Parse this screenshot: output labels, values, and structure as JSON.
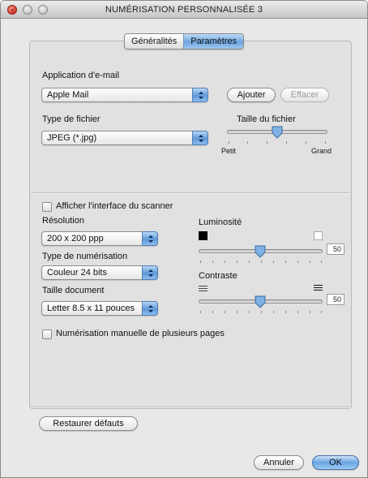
{
  "window": {
    "title": "NUMÉRISATION PERSONNALISÉE 3",
    "icons": [
      "close-icon",
      "minimize-icon",
      "zoom-icon"
    ]
  },
  "tabs": [
    {
      "label": "Généralités",
      "selected": false
    },
    {
      "label": "Paramètres",
      "selected": true
    }
  ],
  "email": {
    "label": "Application d'e-mail",
    "value": "Apple Mail",
    "add_button": "Ajouter",
    "remove_button": "Effacer"
  },
  "file_type": {
    "label": "Type de fichier",
    "value": "JPEG (*.jpg)"
  },
  "file_size": {
    "label": "Taille du fichier",
    "min_label": "Petit",
    "max_label": "Grand",
    "level": 0.5
  },
  "scanner": {
    "show_interface_label": "Afficher l'interface du scanner",
    "show_interface_checked": false,
    "resolution_label": "Résolution",
    "resolution_value": "200 x 200 ppp",
    "scan_type_label": "Type de numérisation",
    "scan_type_value": "Couleur 24 bits",
    "doc_size_label": "Taille document",
    "doc_size_value": "Letter  8.5 x 11 pouces",
    "manual_multi_label": "Numérisation manuelle de plusieurs pages",
    "manual_multi_checked": false
  },
  "brightness": {
    "label": "Luminosité",
    "value": "50",
    "level": 0.5
  },
  "contrast": {
    "label": "Contraste",
    "value": "50",
    "level": 0.5
  },
  "footer": {
    "restore_button": "Restaurer défauts",
    "cancel_button": "Annuler",
    "ok_button": "OK"
  },
  "colors": {
    "accent": "#6fa6e0",
    "window_bg": "#e8e8e8"
  }
}
